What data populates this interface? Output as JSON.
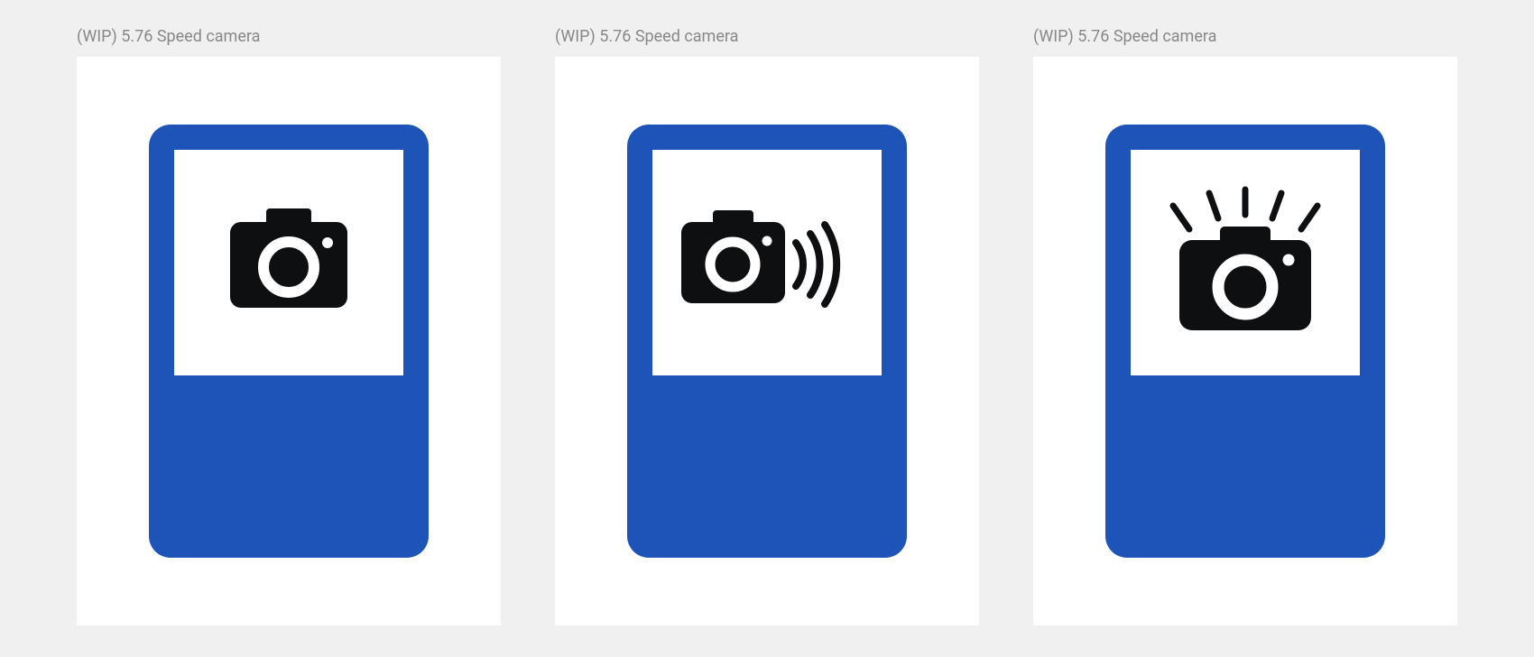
{
  "cards": [
    {
      "title": "(WIP) 5.76 Speed camera",
      "icon": "camera-plain",
      "sign_color": "#1e54b7",
      "icon_color": "#0e0f11"
    },
    {
      "title": "(WIP) 5.76 Speed camera",
      "icon": "camera-waves",
      "sign_color": "#1e54b7",
      "icon_color": "#0e0f11"
    },
    {
      "title": "(WIP) 5.76 Speed camera",
      "icon": "camera-flash",
      "sign_color": "#1e54b7",
      "icon_color": "#0e0f11"
    }
  ]
}
